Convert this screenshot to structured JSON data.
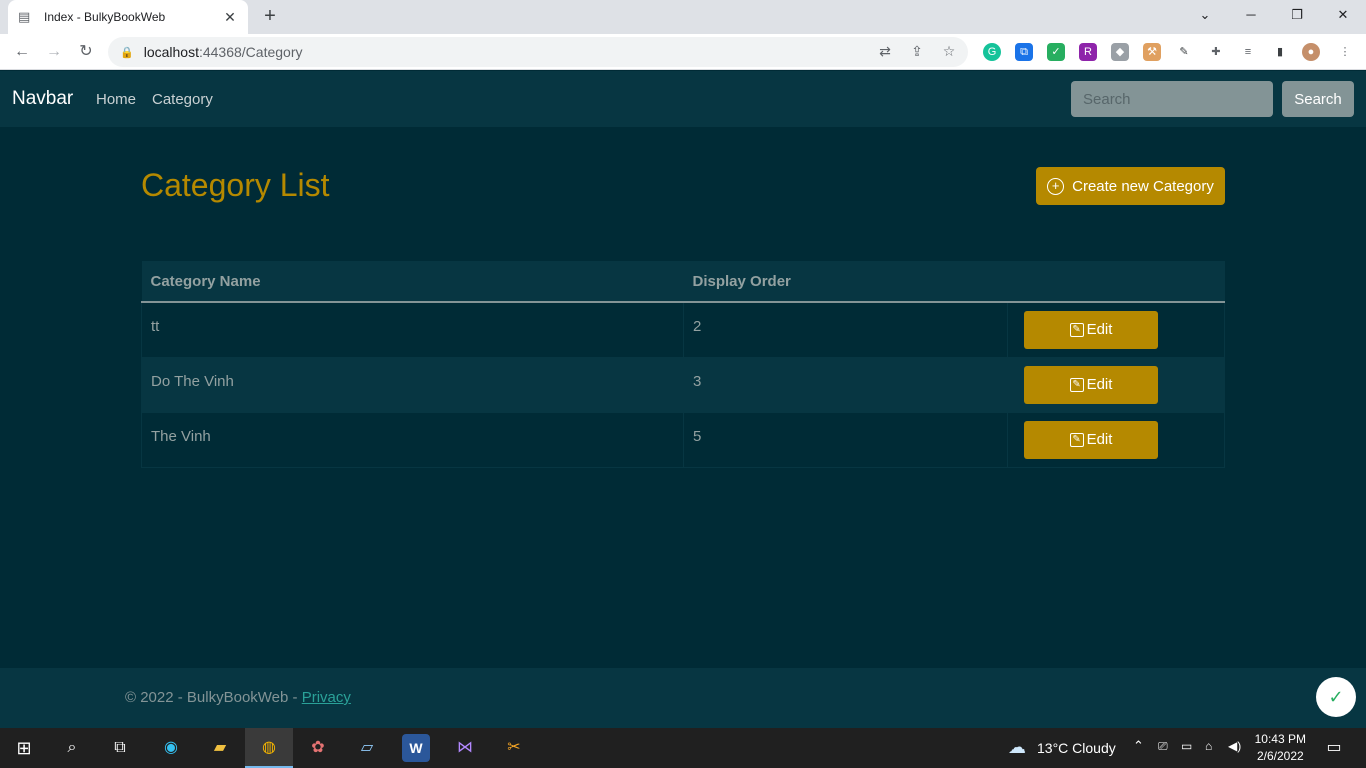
{
  "browser": {
    "tab_title": "Index - BulkyBookWeb",
    "tab_close": "✕",
    "new_tab": "+",
    "url_host": "localhost",
    "url_path": ":44368/Category"
  },
  "navbar": {
    "brand": "Navbar",
    "links": [
      "Home",
      "Category"
    ],
    "search_placeholder": "Search",
    "search_button": "Search"
  },
  "main": {
    "heading": "Category List",
    "create_button": "Create new Category",
    "table": {
      "headers": [
        "Category Name",
        "Display Order",
        ""
      ],
      "rows": [
        {
          "name": "tt",
          "order": "2",
          "action": "Edit"
        },
        {
          "name": "Do The Vinh",
          "order": "3",
          "action": "Edit"
        },
        {
          "name": "The Vinh",
          "order": "5",
          "action": "Edit"
        }
      ]
    }
  },
  "footer": {
    "text": "© 2022 - BulkyBookWeb - ",
    "link": "Privacy"
  },
  "taskbar": {
    "weather": "13°C  Cloudy",
    "time": "10:43 PM",
    "date": "2/6/2022"
  },
  "colors": {
    "accent": "#b58900",
    "background": "#002b36",
    "navbar": "#073642"
  }
}
